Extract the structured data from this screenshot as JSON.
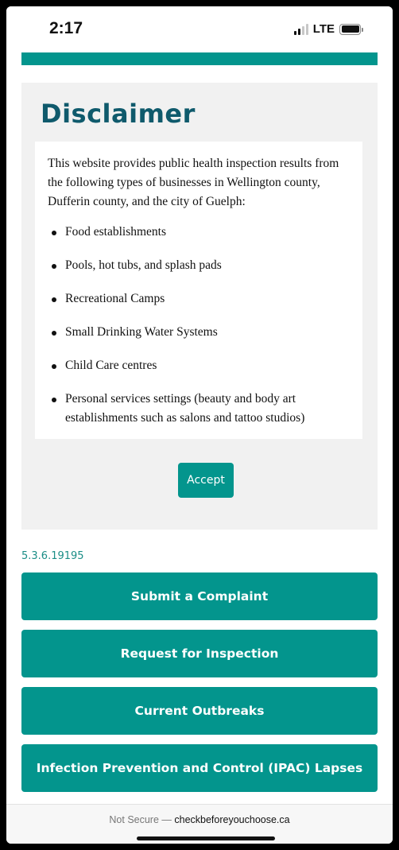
{
  "status_bar": {
    "time": "2:17",
    "network": "LTE",
    "icons": {
      "signal": "signal-icon",
      "battery": "battery-icon"
    }
  },
  "disclaimer": {
    "title": "Disclaimer",
    "intro": "This website provides public health inspection results from the following types of businesses in Wellington county, Dufferin county, and the city of Guelph:",
    "items": [
      "Food establishments",
      "Pools, hot tubs, and splash pads",
      "Recreational Camps",
      "Small Drinking Water Systems",
      "Child Care centres",
      "Personal services settings (beauty and body art establishments such as salons and tattoo studios)"
    ],
    "accept_label": "Accept"
  },
  "version": "5.3.6.19195",
  "actions": [
    "Submit a Complaint",
    "Request for Inspection",
    "Current Outbreaks",
    "Infection Prevention and Control (IPAC) Lapses"
  ],
  "browser": {
    "security_label": "Not Secure — ",
    "domain": "checkbeforeyouchoose.ca"
  },
  "colors": {
    "accent": "#03958d",
    "title": "#0f5a6c",
    "panel_bg": "#f1f1f1"
  }
}
